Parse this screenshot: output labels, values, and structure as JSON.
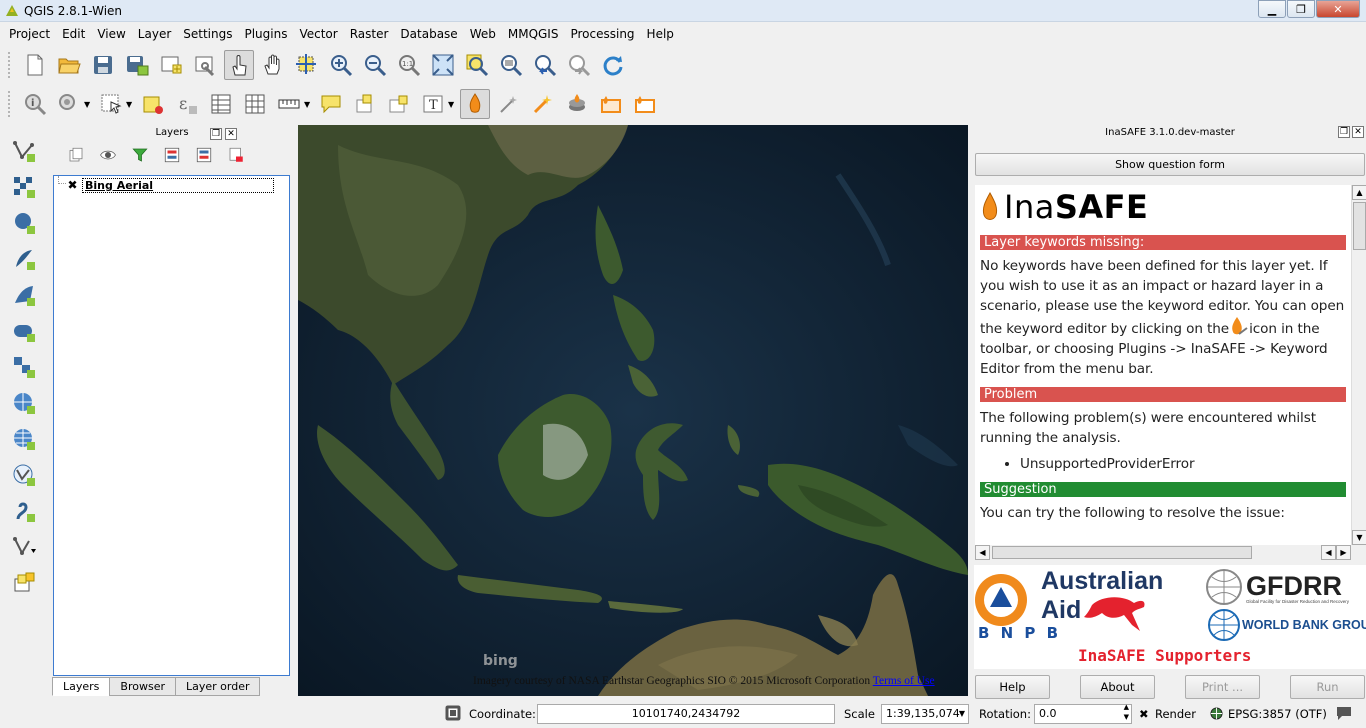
{
  "window": {
    "title": "QGIS 2.8.1-Wien",
    "controls": [
      "minimize",
      "restore",
      "close"
    ]
  },
  "menu": [
    "Project",
    "Edit",
    "View",
    "Layer",
    "Settings",
    "Plugins",
    "Vector",
    "Raster",
    "Database",
    "Web",
    "MMQGIS",
    "Processing",
    "Help"
  ],
  "toolbar1": [
    "new-project-icon",
    "open-project-icon",
    "save-project-icon",
    "save-as-icon",
    "new-print-composer-icon",
    "composer-manager-icon",
    "touch-zoom-icon",
    "pan-icon",
    "pan-to-selection-icon",
    "zoom-in-icon",
    "zoom-out-icon",
    "zoom-native-icon",
    "zoom-full-icon",
    "zoom-to-selection-icon",
    "zoom-to-layer-icon",
    "zoom-last-icon",
    "zoom-next-icon",
    "refresh-icon"
  ],
  "toolbar2": [
    "identify-icon",
    "run-feature-action-icon",
    "select-features-icon",
    "deselect-icon",
    "field-calculator-icon",
    "attribute-table-icon",
    "statistical-summary-icon",
    "measure-icon",
    "map-tips-icon",
    "new-bookmark-icon",
    "show-bookmarks-icon",
    "text-annotation-icon",
    "inasafe-keywords-icon",
    "inasafe-wizard-icon",
    "inasafe-dock-icon",
    "inasafe-batch-icon",
    "inasafe-extent-icon",
    "inasafe-clip-icon"
  ],
  "left_toolbar": [
    "add-vector-layer-icon",
    "add-raster-layer-icon",
    "add-postgis-layer-icon",
    "add-spatialite-layer-icon",
    "add-mssql-layer-icon",
    "add-oracle-layer-icon",
    "add-wms-layer-icon",
    "add-wcs-layer-icon",
    "add-wfs-layer-icon",
    "add-delimited-text-icon",
    "new-shapefile-icon",
    "new-virtual-layer-icon"
  ],
  "layers_panel": {
    "title": "Layers",
    "tools": [
      "add-group-icon",
      "manage-visibility-icon",
      "filter-legend-icon",
      "expand-all-icon",
      "collapse-all-icon",
      "remove-layer-icon"
    ],
    "items": [
      {
        "name": "Bing Aerial",
        "checked": true
      }
    ],
    "tabs": [
      "Layers",
      "Browser",
      "Layer order"
    ]
  },
  "map": {
    "watermark": "bing",
    "attribution": "Imagery courtesy of NASA Earthstar Geographics SIO © 2015 Microsoft Corporation",
    "attribution_link": "Terms of Use"
  },
  "inasafe": {
    "title": "InaSAFE 3.1.0.dev-master",
    "question_button": "Show question form",
    "logo_light": "Ina",
    "logo_bold": "SAFE",
    "sections": [
      {
        "heading": "Layer keywords missing:",
        "color": "#d9534f"
      },
      {
        "heading": "Problem",
        "color": "#d9534f"
      },
      {
        "heading": "Suggestion",
        "color": "#218c32"
      }
    ],
    "keywords_text_a": "No keywords have been defined for this layer yet. If you wish to use it as an impact or hazard layer in a scenario, please use the keyword editor. You can open the keyword editor by clicking on the",
    "keywords_text_b": "icon in the toolbar, or choosing Plugins -> InaSAFE -> Keyword Editor from the menu bar.",
    "problem_text": "The following problem(s) were encountered whilst running the analysis.",
    "problem_item": "UnsupportedProviderError",
    "suggestion_text": "You can try the following to resolve the issue:",
    "sponsors": {
      "bnpb": "B N P B",
      "aus_line1": "Australian",
      "aus_line2": "Aid",
      "gfdrr": "GFDRR",
      "gfdrr_sub": "Global Facility for Disaster Reduction and Recovery",
      "worldbank": "WORLD BANK GROUP",
      "caption": "InaSAFE Supporters"
    },
    "buttons": {
      "help": "Help",
      "about": "About",
      "print": "Print ...",
      "run": "Run"
    }
  },
  "statusbar": {
    "coordinate_label": "Coordinate:",
    "coordinate_value": "10101740,2434792",
    "scale_label": "Scale",
    "scale_value": "1:39,135,074",
    "rotation_label": "Rotation:",
    "rotation_value": "0.0",
    "render_label": "Render",
    "crs": "EPSG:3857 (OTF)"
  }
}
